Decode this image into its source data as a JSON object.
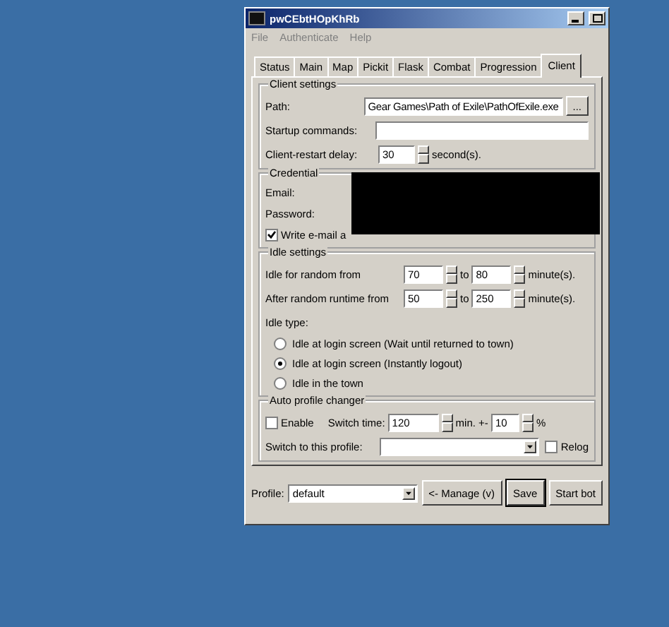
{
  "window": {
    "title": "pwCEbtHOpKhRb"
  },
  "menu": [
    "File",
    "Authenticate",
    "Help"
  ],
  "tabs": [
    {
      "label": "Status",
      "selected": false
    },
    {
      "label": "Main",
      "selected": false
    },
    {
      "label": "Map",
      "selected": false
    },
    {
      "label": "Pickit",
      "selected": false
    },
    {
      "label": "Flask",
      "selected": false
    },
    {
      "label": "Combat",
      "selected": false
    },
    {
      "label": "Progression",
      "selected": false
    },
    {
      "label": "Client",
      "selected": true
    }
  ],
  "client_settings": {
    "title": "Client settings",
    "path_label": "Path:",
    "path": "Gear Games\\Path of Exile\\PathOfExile.exe",
    "browse": "...",
    "startup_label": "Startup commands:",
    "restart_label": "Client-restart delay:",
    "restart_delay": "30",
    "restart_unit": "second(s)."
  },
  "credential": {
    "title": "Credential",
    "email_label": "Email:",
    "password_label": "Password:",
    "write_checkbox": {
      "label": "Write e-mail a",
      "checked": true
    }
  },
  "idle_settings": {
    "title": "Idle settings",
    "rows": [
      {
        "label": "Idle for random from",
        "from": "70",
        "to_label": "to",
        "to": "80",
        "unit": "minute(s)."
      },
      {
        "label": "After random runtime from",
        "from": "50",
        "to_label": "to",
        "to": "250",
        "unit": "minute(s)."
      }
    ],
    "type_label": "Idle type:",
    "options": [
      {
        "label": "Idle at login screen (Wait until returned to town)",
        "selected": false
      },
      {
        "label": "Idle at login screen (Instantly logout)",
        "selected": true
      },
      {
        "label": "Idle in the town",
        "selected": false
      }
    ]
  },
  "auto_profile": {
    "title": "Auto profile changer",
    "enable": {
      "label": "Enable",
      "checked": false
    },
    "switch_time_label": "Switch time:",
    "switch_time": "120",
    "min_label": "min. +-",
    "percent": "10",
    "percent_label": "%",
    "switch_profile_label": "Switch to this profile:",
    "relog": {
      "label": "Relog",
      "checked": false
    }
  },
  "footer": {
    "profile_label": "Profile:",
    "profile": "default",
    "buttons": [
      {
        "label": "<- Manage (v)",
        "default": false
      },
      {
        "label": "Save",
        "default": true
      },
      {
        "label": "Start bot",
        "default": false
      }
    ]
  }
}
